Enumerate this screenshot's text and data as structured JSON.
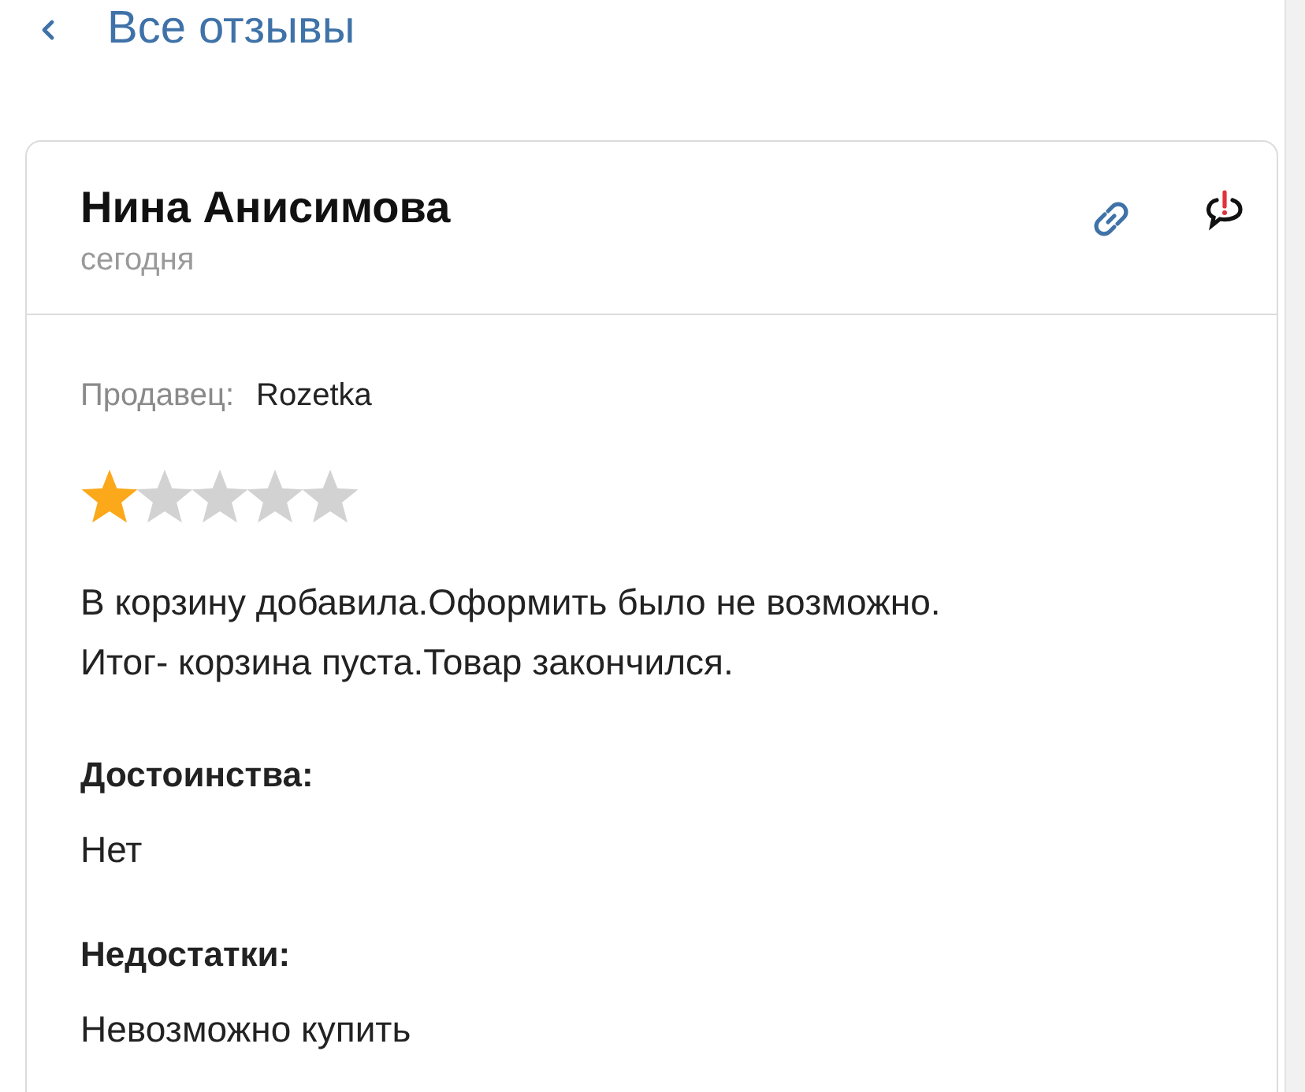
{
  "back_link": {
    "label": "Все отзывы"
  },
  "review": {
    "author": "Нина Анисимова",
    "date": "сегодня",
    "seller": {
      "label": "Продавец:",
      "value": "Rozetka"
    },
    "stars": 1,
    "text": "В корзину добавила.Оформить было не возможно.\nИтог- корзина пуста.Товар закончился.",
    "sections": [
      {
        "title": "Достоинства:",
        "text": "Нет"
      },
      {
        "title": "Недостатки:",
        "text": "Невозможно купить"
      }
    ]
  }
}
